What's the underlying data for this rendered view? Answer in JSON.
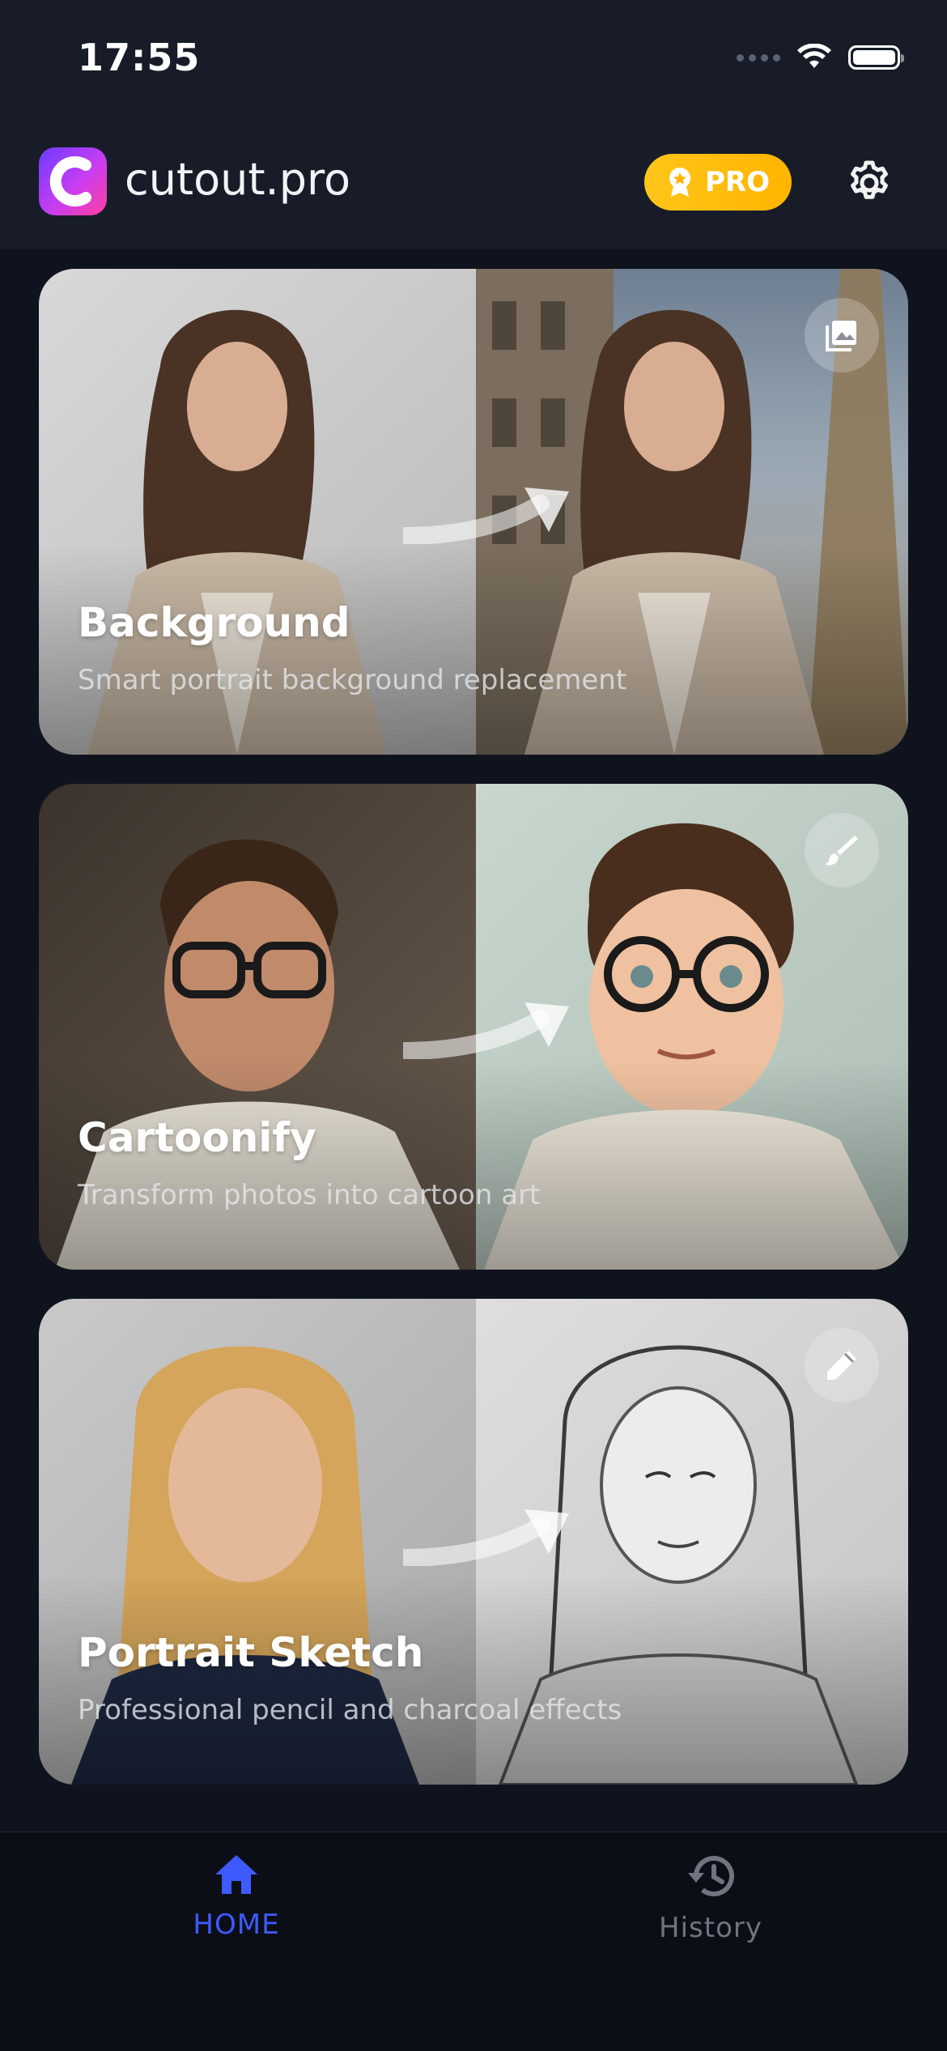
{
  "status_bar": {
    "time": "17:55"
  },
  "header": {
    "app_name": "cutout.pro",
    "pro_label": "PRO",
    "logo_icon": "cutout-logo-icon",
    "settings_icon": "gear-icon"
  },
  "cards": [
    {
      "title": "Background",
      "subtitle": "Smart portrait background replacement",
      "icon": "image-icon"
    },
    {
      "title": "Cartoonify",
      "subtitle": "Transform photos into cartoon art",
      "icon": "brush-icon"
    },
    {
      "title": "Portrait Sketch",
      "subtitle": "Professional pencil and charcoal effects",
      "icon": "pencil-icon"
    }
  ],
  "bottom_nav": {
    "items": [
      {
        "label": "HOME",
        "icon": "home-icon",
        "active": true
      },
      {
        "label": "History",
        "icon": "history-icon",
        "active": false
      }
    ]
  },
  "colors": {
    "background": "#0f131d",
    "header": "#171c28",
    "pro_gold": "#ffb400",
    "active_nav": "#3d5afe",
    "inactive_nav": "#6f7480"
  }
}
